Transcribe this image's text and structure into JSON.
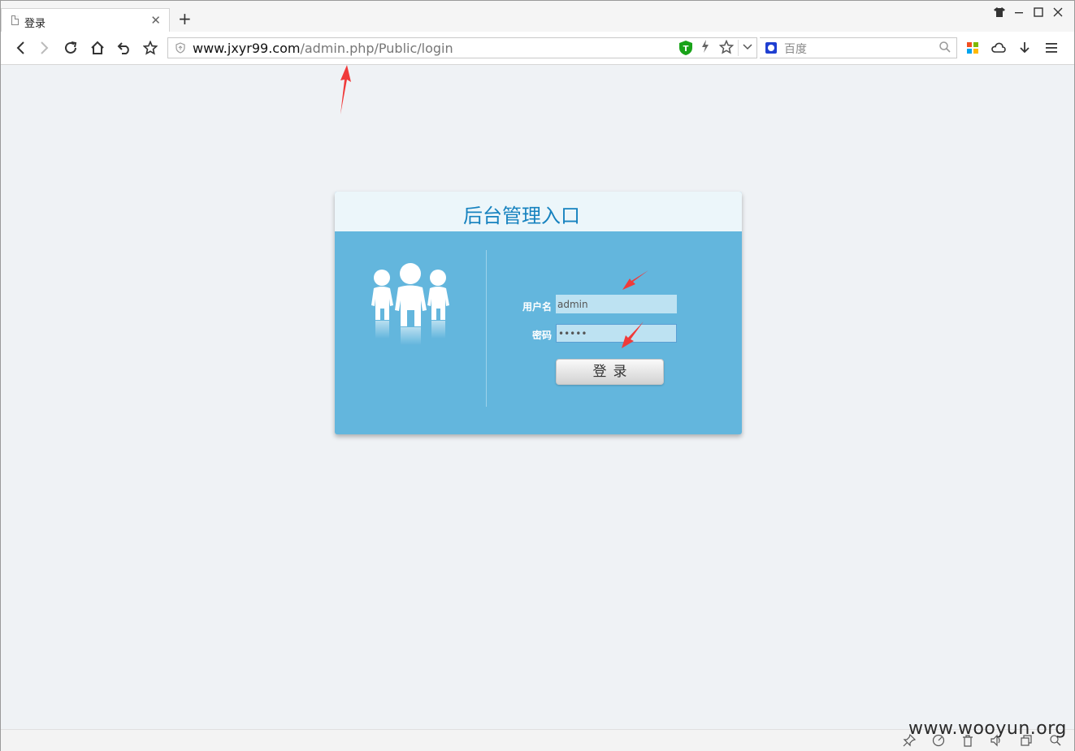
{
  "browser": {
    "tab": {
      "title": "登录"
    },
    "new_tab_label": "+",
    "url": {
      "host": "www.jxyr99.com",
      "path": "/admin.php/Public/login"
    },
    "search": {
      "placeholder": "百度"
    }
  },
  "login": {
    "title": "后台管理入口",
    "username_label": "用户名",
    "username_value": "admin",
    "password_label": "密码",
    "password_value": "•••••",
    "submit_label": "登录"
  },
  "watermark": "www.wooyun.org",
  "colors": {
    "panel": "#63b6dd",
    "header": "#ecf6fa",
    "title": "#1682bf",
    "field": "#bde2f2",
    "annotation": "#f03a3a"
  }
}
